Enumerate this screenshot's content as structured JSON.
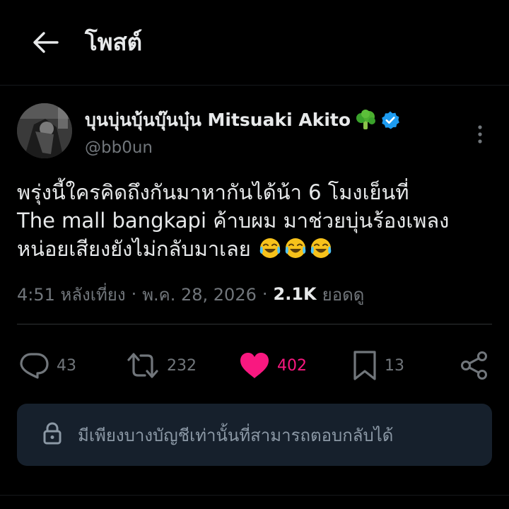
{
  "header": {
    "title": "โพสต์",
    "back_icon": "arrow-left-icon"
  },
  "author": {
    "display_name": "บุนบุ่นบุ้นบุ๊นบุ๋น Mitsuaki Akito",
    "name_emoji": "broccoli-icon",
    "verified_icon": "verified-badge-icon",
    "handle": "@bb0un",
    "avatar_icon": "avatar"
  },
  "tweet": {
    "line1": "พรุ่งนี้ใครคิดถึงกันมาหากันได้น้า 6 โมงเย็นที่",
    "line2": "The mall bangkapi ค้าบผม มาช่วยบุ่นร้องเพลง",
    "line3": "หน่อยเสียงยังไม่กลับมาเลย",
    "emoji_icon": "laughing-tears-icon"
  },
  "meta": {
    "time": "4:51 หลังเที่ยง",
    "separator": "·",
    "date": "พ.ค. 28, 2026",
    "views_count": "2.1K",
    "views_label": "ยอดดู"
  },
  "actions": {
    "replies": "43",
    "reposts": "232",
    "likes": "402",
    "bookmarks": "13"
  },
  "reply_restriction": {
    "text": "มีเพียงบางบัญชีเท่านั้นที่สามารถตอบกลับได้",
    "icon": "lock-icon"
  },
  "colors": {
    "background": "#000000",
    "text": "#e7e9ea",
    "muted": "#71767b",
    "like": "#f91880",
    "verified": "#1d9bf0",
    "reply_box": "#16202c"
  }
}
